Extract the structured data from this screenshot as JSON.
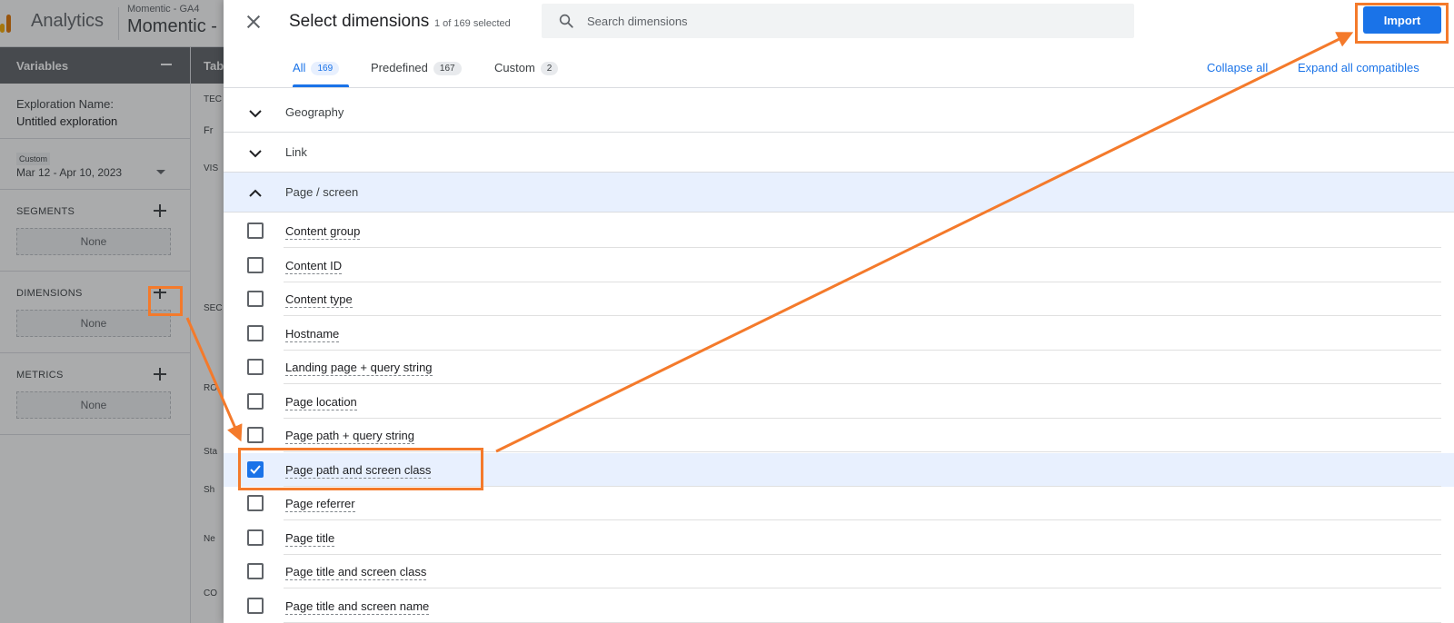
{
  "app": {
    "brand": "Analytics",
    "account": "Momentic - GA4",
    "property": "Momentic -",
    "colors": {
      "logo_orange": "#f9ab00",
      "logo_dark": "#e37400",
      "header_gray": "#5f6368"
    }
  },
  "variables": {
    "title": "Variables",
    "exploration_label": "Exploration Name:",
    "exploration_name": "Untitled exploration",
    "date_chip": "Custom",
    "date_range": "Mar 12 - Apr 10, 2023",
    "segments": {
      "label": "SEGMENTS",
      "value": "None"
    },
    "dimensions": {
      "label": "DIMENSIONS",
      "value": "None"
    },
    "metrics": {
      "label": "METRICS",
      "value": "None"
    }
  },
  "tab_settings": {
    "title": "Tab",
    "fragments": [
      "TEC",
      "Fr",
      "VIS",
      "SEC",
      "RO",
      "Sta",
      "Sh",
      "Ne",
      "CO"
    ]
  },
  "dialog": {
    "title": "Select dimensions",
    "selection_count": "1 of 169 selected",
    "search_placeholder": "Search dimensions",
    "import_label": "Import",
    "tabs": [
      {
        "label": "All",
        "count": "169",
        "active": true
      },
      {
        "label": "Predefined",
        "count": "167",
        "active": false
      },
      {
        "label": "Custom",
        "count": "2",
        "active": false
      }
    ],
    "collapse_all": "Collapse all",
    "expand_all": "Expand all compatibles",
    "categories": [
      {
        "label": "Geography",
        "expanded": false
      },
      {
        "label": "Link",
        "expanded": false
      },
      {
        "label": "Page / screen",
        "expanded": true
      }
    ],
    "items": [
      {
        "label": "Content group",
        "checked": false
      },
      {
        "label": "Content ID",
        "checked": false
      },
      {
        "label": "Content type",
        "checked": false
      },
      {
        "label": "Hostname",
        "checked": false
      },
      {
        "label": "Landing page + query string",
        "checked": false
      },
      {
        "label": "Page location",
        "checked": false
      },
      {
        "label": "Page path + query string",
        "checked": false
      },
      {
        "label": "Page path and screen class",
        "checked": true
      },
      {
        "label": "Page referrer",
        "checked": false
      },
      {
        "label": "Page title",
        "checked": false
      },
      {
        "label": "Page title and screen class",
        "checked": false
      },
      {
        "label": "Page title and screen name",
        "checked": false
      }
    ],
    "accent_color": "#1a73e8",
    "annotation_color": "#f47a2b"
  }
}
